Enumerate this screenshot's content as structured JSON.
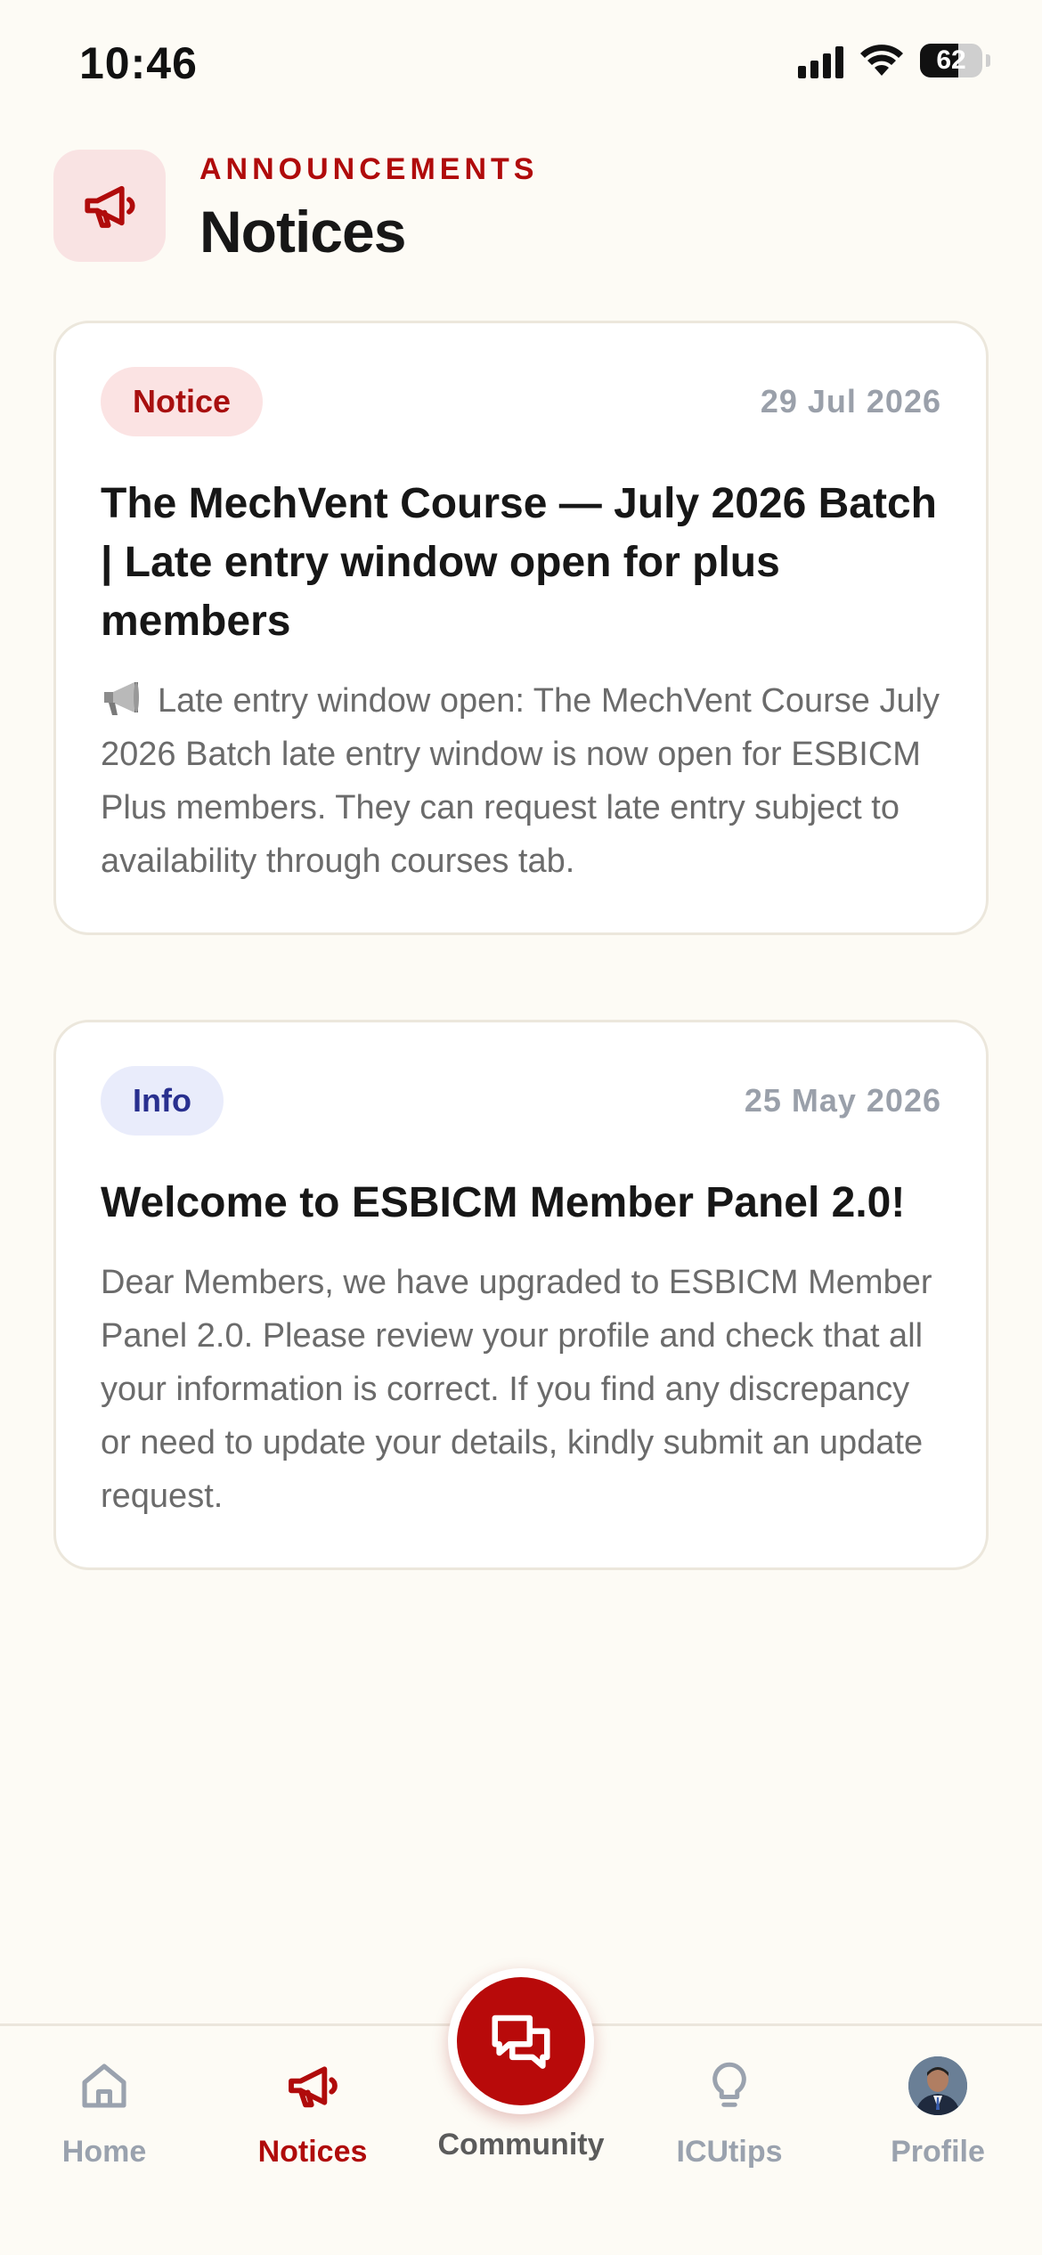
{
  "status_bar": {
    "time": "10:46",
    "battery_percent": "62",
    "battery_level": 0.62
  },
  "header": {
    "eyebrow": "ANNOUNCEMENTS",
    "title": "Notices",
    "icon": "megaphone-icon"
  },
  "notices": [
    {
      "badge": "Notice",
      "date": "29 Jul 2026",
      "title": "The MechVent Course — July 2026 Batch |  Late entry window open for plus members",
      "body": "Late entry window open: The MechVent Course July 2026 Batch late entry window is now open for ESBICM Plus members. They can request late entry subject to availability through courses tab.",
      "body_icon": "megaphone-emoji-icon"
    },
    {
      "badge": "Info",
      "date": "25 May 2026",
      "title": "Welcome to ESBICM Member Panel 2.0!",
      "body": "Dear Members, we have upgraded to ESBICM Member Panel 2.0. Please review your profile and check that all your information is correct. If you find any discrepancy or need to update your details, kindly submit an update request."
    }
  ],
  "nav": {
    "home": "Home",
    "notices": "Notices",
    "community": "Community",
    "icutips": "ICUtips",
    "profile": "Profile",
    "active": "notices"
  },
  "colors": {
    "accent": "#b00b0b",
    "background": "#fdfbf5",
    "notice_badge_bg": "#fbe3e3",
    "info_badge_bg": "#e9ecfb",
    "info_badge_text": "#29308f",
    "inactive_nav": "#9aa2ae"
  }
}
